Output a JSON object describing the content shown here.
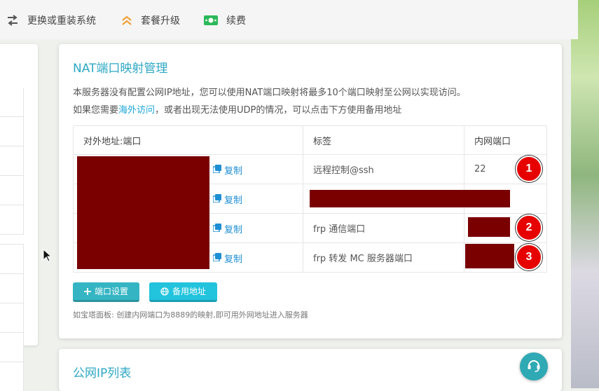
{
  "toolbar": {
    "reinstall_label": "更换或重装系统",
    "upgrade_label": "套餐升级",
    "renew_label": "续费"
  },
  "nat": {
    "title": "NAT端口映射管理",
    "desc_line1": "本服务器没有配置公网IP地址，您可以使用NAT端口映射将最多10个端口映射至公网以实现访问。",
    "desc_line2_pre": "如果您需要",
    "desc_line2_link": "海外访问",
    "desc_line2_post": "，或者出现无法使用UDP的情况，可以点击下方使用备用地址",
    "columns": [
      "对外地址:端口",
      "标签",
      "内网端口"
    ],
    "rows": [
      {
        "copy": "复制",
        "tag": "远程控制@ssh",
        "port": "22",
        "badge": "1"
      },
      {
        "copy": "复制",
        "tag": "",
        "port": "",
        "badge": ""
      },
      {
        "copy": "复制",
        "tag": "frp 通信端口",
        "port": "",
        "badge": "2"
      },
      {
        "copy": "复制",
        "tag": "frp 转发 MC 服务器端口",
        "port": "",
        "badge": "3"
      }
    ],
    "port_settings_label": "端口设置",
    "backup_address_label": "备用地址",
    "footnote": "如宝塔面板: 创建内网端口为8889的映射,即可用外网地址进入服务器"
  },
  "public_ip": {
    "title": "公网IP列表"
  },
  "colors": {
    "accent": "#2ea8c4",
    "link": "#1f8fd4",
    "redaction": "#7a0000",
    "badge": "#e60000"
  }
}
